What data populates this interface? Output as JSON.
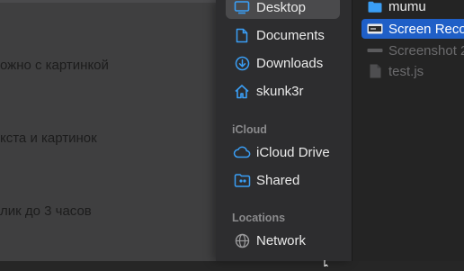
{
  "background_text": [
    "ожно с картинкой",
    "кста и картинок",
    "лик до 3 часов"
  ],
  "sidebar": {
    "favorites": [
      {
        "label": "Desktop",
        "icon": "desktop-icon",
        "selected": true
      },
      {
        "label": "Documents",
        "icon": "document-icon"
      },
      {
        "label": "Downloads",
        "icon": "download-icon"
      },
      {
        "label": "skunk3r",
        "icon": "home-icon"
      }
    ],
    "icloud_header": "iCloud",
    "icloud": [
      {
        "label": "iCloud Drive",
        "icon": "cloud-icon"
      },
      {
        "label": "Shared",
        "icon": "shared-folder-icon"
      }
    ],
    "locations_header": "Locations",
    "locations": [
      {
        "label": "Network",
        "icon": "globe-icon"
      }
    ]
  },
  "files": [
    {
      "label": "mumu",
      "icon": "folder-icon"
    },
    {
      "label": "Screen Reco",
      "icon": "video-file-icon",
      "selected": true
    },
    {
      "label": "Screenshot 2",
      "icon": "image-file-icon",
      "dim": true
    },
    {
      "label": "test.js",
      "icon": "js-file-icon",
      "dim": true
    }
  ],
  "colors": {
    "accent": "#3a9ef5",
    "selection": "#1f5fc7",
    "sidebar_bg": "#2d2d2f"
  }
}
